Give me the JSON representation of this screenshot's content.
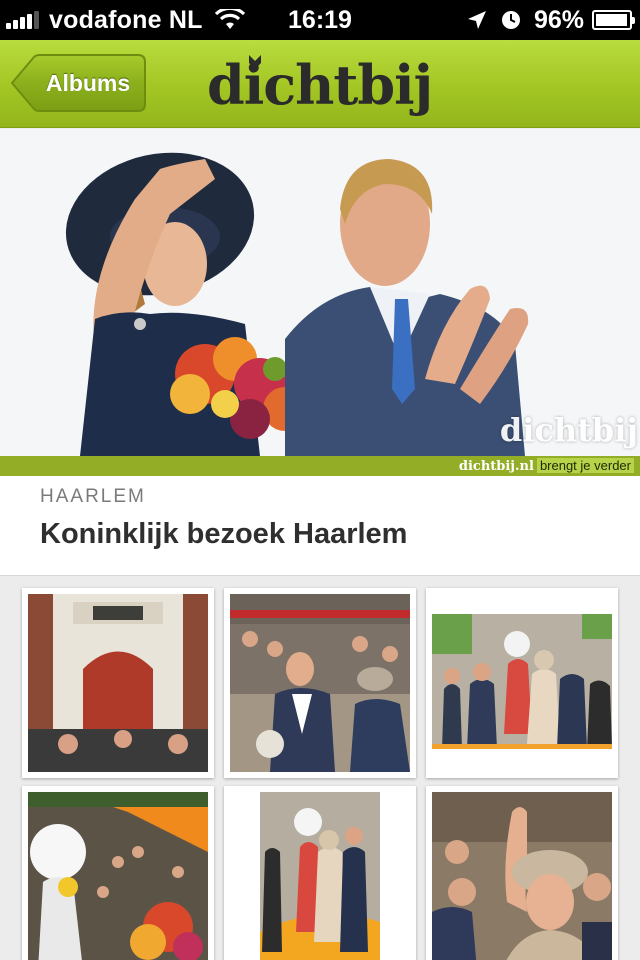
{
  "status_bar": {
    "carrier": "vodafone NL",
    "time": "16:19",
    "battery_percent": "96%",
    "signal_bars": 4,
    "icons": [
      "signal-icon",
      "wifi-icon",
      "location-arrow-icon",
      "alarm-clock-icon",
      "battery-icon"
    ]
  },
  "nav": {
    "back_label": "Albums",
    "logo_text": "dichtbij",
    "colors": {
      "bar": "#a3c624",
      "button": "#8cb01c"
    }
  },
  "hero": {
    "watermark": "dichtbij",
    "tag_site": "dichtbij.nl",
    "tag_slogan": "brengt je verder"
  },
  "album": {
    "city": "HAARLEM",
    "title": "Koninklijk bezoek Haarlem"
  },
  "thumbnails": [
    {
      "name": "photo-town-hall-door"
    },
    {
      "name": "photo-king-crowd"
    },
    {
      "name": "photo-queen-ceremony"
    },
    {
      "name": "photo-festival-crowd"
    },
    {
      "name": "photo-orange-carpet"
    },
    {
      "name": "photo-queen-waving"
    }
  ]
}
